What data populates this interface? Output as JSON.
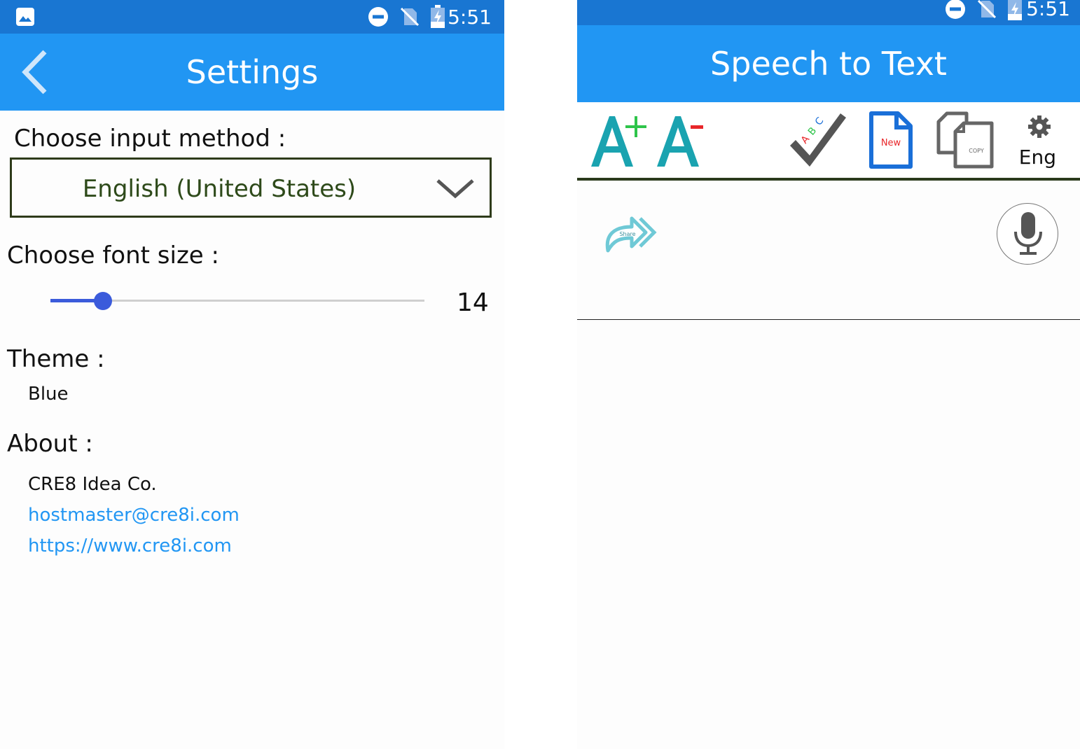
{
  "left": {
    "status_time": "5:51",
    "title": "Settings",
    "input_method_label": "Choose input method :",
    "input_method_value": "English (United States)",
    "font_size_label": "Choose font size :",
    "font_size_value": "14",
    "font_size_fraction": 0.14,
    "theme_label": "Theme :",
    "theme_value": "Blue",
    "about_label": "About :",
    "company": "CRE8 Idea Co.",
    "email": "hostmaster@cre8i.com",
    "website": "https://www.cre8i.com",
    "icons": [
      "image-icon",
      "dnd-icon",
      "no-sim-icon",
      "battery-icon",
      "back-arrow-icon",
      "chevron-down-icon"
    ]
  },
  "right": {
    "status_time": "5:51",
    "title": "Speech to Text",
    "language": "Eng",
    "new_doc_text": "New",
    "copy_text": "COPY",
    "share_text": "Share",
    "spell_check_letters": [
      "A",
      "B",
      "C"
    ],
    "increase_font_symbol": "+",
    "icons": [
      "font-increase-icon",
      "font-decrease-icon",
      "spell-check-icon",
      "new-document-icon",
      "copy-icon",
      "gear-icon",
      "share-icon",
      "microphone-icon"
    ]
  },
  "colors": {
    "status_bar": "#1976d2",
    "app_bar": "#2196f3",
    "link": "#2196f3",
    "slider": "#3b5bdb",
    "teal": "#1aa3b0"
  }
}
